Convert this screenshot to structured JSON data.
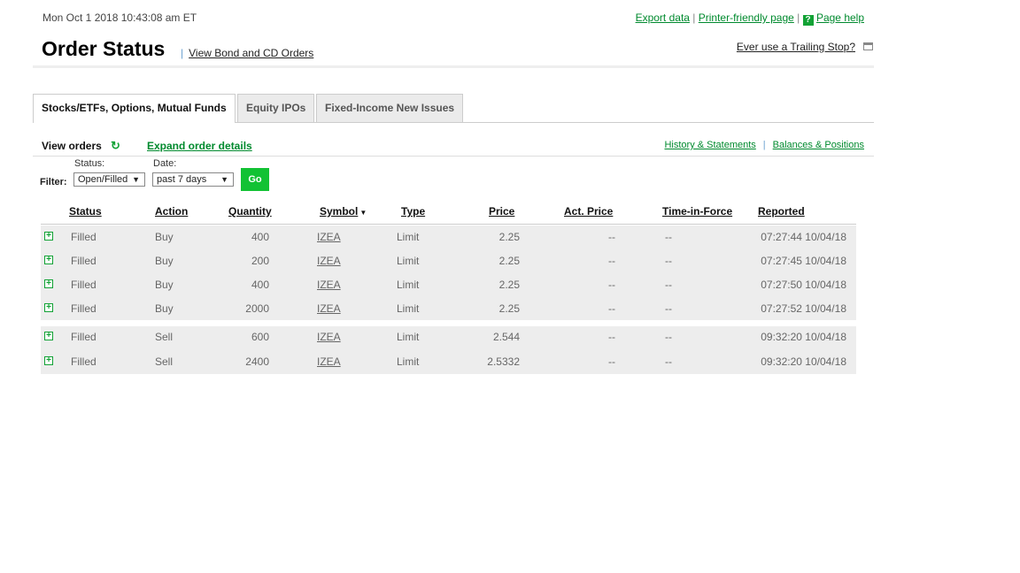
{
  "header": {
    "datetime": "Mon Oct 1 2018 10:43:08 am ET",
    "export": "Export data",
    "printer": "Printer-friendly page",
    "help_icon": "?",
    "help": "Page help",
    "title": "Order Status",
    "sep": "|",
    "bond_link": "View Bond and CD Orders",
    "trailing": "Ever use a Trailing Stop?"
  },
  "tabs": [
    {
      "label": "Stocks/ETFs, Options, Mutual Funds"
    },
    {
      "label": "Equity IPOs"
    },
    {
      "label": "Fixed-Income New Issues"
    }
  ],
  "toolbar": {
    "view_orders": "View orders",
    "expand": "Expand order details",
    "history": "History & Statements",
    "balances": "Balances & Positions"
  },
  "filter": {
    "label": "Filter:",
    "status_label": "Status:",
    "status_value": "Open/Filled",
    "date_label": "Date:",
    "date_value": "past 7 days",
    "go": "Go"
  },
  "columns": [
    "Status",
    "Action",
    "Quantity",
    "Symbol",
    "Type",
    "Price",
    "Act. Price",
    "Time-in-Force",
    "Reported"
  ],
  "groups": [
    [
      {
        "status": "Filled",
        "action": "Buy",
        "qty": "400",
        "symbol": "IZEA",
        "type": "Limit",
        "price": "2.25",
        "act": "--",
        "tif": "--",
        "reported": "07:27:44 10/04/18"
      },
      {
        "status": "Filled",
        "action": "Buy",
        "qty": "200",
        "symbol": "IZEA",
        "type": "Limit",
        "price": "2.25",
        "act": "--",
        "tif": "--",
        "reported": "07:27:45 10/04/18"
      },
      {
        "status": "Filled",
        "action": "Buy",
        "qty": "400",
        "symbol": "IZEA",
        "type": "Limit",
        "price": "2.25",
        "act": "--",
        "tif": "--",
        "reported": "07:27:50 10/04/18"
      },
      {
        "status": "Filled",
        "action": "Buy",
        "qty": "2000",
        "symbol": "IZEA",
        "type": "Limit",
        "price": "2.25",
        "act": "--",
        "tif": "--",
        "reported": "07:27:52 10/04/18"
      }
    ],
    [
      {
        "status": "Filled",
        "action": "Sell",
        "qty": "600",
        "symbol": "IZEA",
        "type": "Limit",
        "price": "2.544",
        "act": "--",
        "tif": "--",
        "reported": "09:32:20 10/04/18"
      },
      {
        "status": "Filled",
        "action": "Sell",
        "qty": "2400",
        "symbol": "IZEA",
        "type": "Limit",
        "price": "2.5332",
        "act": "--",
        "tif": "--",
        "reported": "09:32:20 10/04/18"
      }
    ]
  ]
}
